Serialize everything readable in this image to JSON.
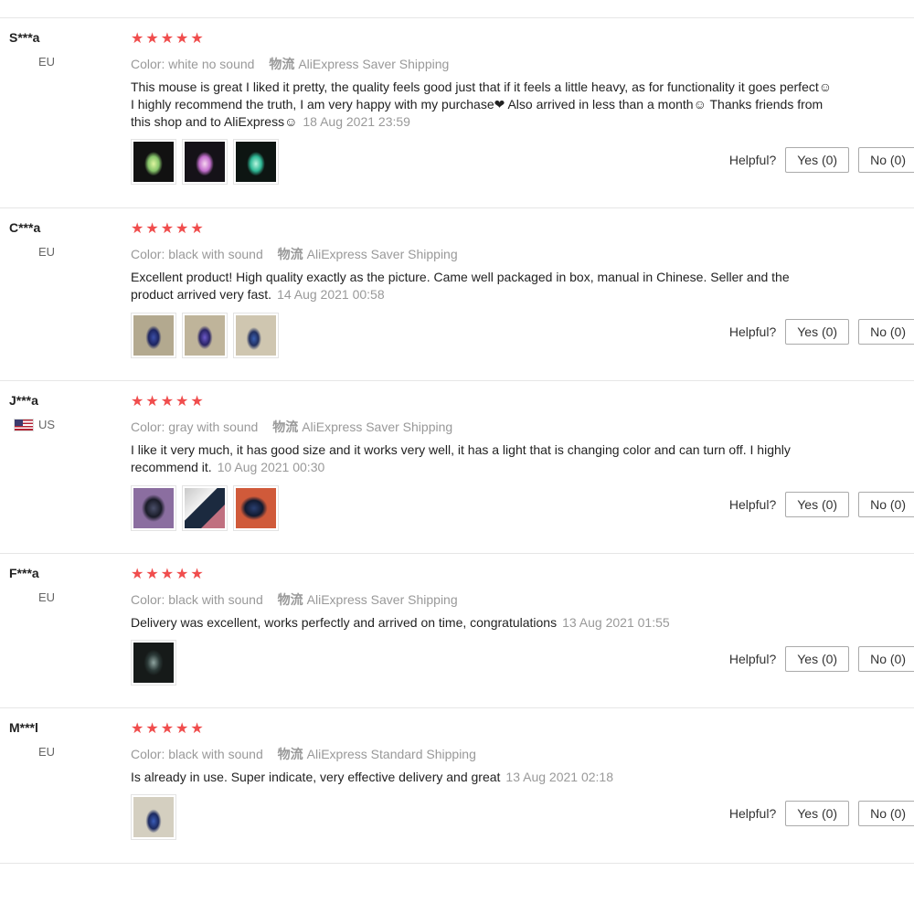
{
  "helpful_label": "Helpful?",
  "reviews": [
    {
      "name": "S***a",
      "country": "EU",
      "stars": "★★★★★",
      "color_label": "Color:",
      "color_value": "white no sound",
      "ship_cn": "物流",
      "shipping": "AliExpress Saver Shipping",
      "text": "This mouse is great I liked it pretty, the quality feels good just that if it feels a little heavy, as for functionality it goes perfect☺ I highly recommend the truth, I am very happy with my purchase❤ Also arrived in less than a month☺ Thanks friends from this shop and to AliExpress☺",
      "date": "18 Aug 2021 23:59",
      "yes": "Yes (0)",
      "no": "No (0)"
    },
    {
      "name": "C***a",
      "country": "EU",
      "stars": "★★★★★",
      "color_label": "Color:",
      "color_value": "black with sound",
      "ship_cn": "物流",
      "shipping": "AliExpress Saver Shipping",
      "text": "Excellent product! High quality exactly as the picture. Came well packaged in box, manual in Chinese. Seller and the product arrived very fast.",
      "date": "14 Aug 2021 00:58",
      "yes": "Yes (0)",
      "no": "No (0)"
    },
    {
      "name": "J***a",
      "country": "US",
      "stars": "★★★★★",
      "color_label": "Color:",
      "color_value": "gray with sound",
      "ship_cn": "物流",
      "shipping": "AliExpress Saver Shipping",
      "text": "I like it very much, it has good size and it works very well, it has a light that is changing color and can turn off. I highly recommend it.",
      "date": "10 Aug 2021 00:30",
      "yes": "Yes (0)",
      "no": "No (0)"
    },
    {
      "name": "F***a",
      "country": "EU",
      "stars": "★★★★★",
      "color_label": "Color:",
      "color_value": "black with sound",
      "ship_cn": "物流",
      "shipping": "AliExpress Saver Shipping",
      "text": "Delivery was excellent, works perfectly and arrived on time, congratulations",
      "date": "13 Aug 2021 01:55",
      "yes": "Yes (0)",
      "no": "No (0)"
    },
    {
      "name": "M***l",
      "country": "EU",
      "stars": "★★★★★",
      "color_label": "Color:",
      "color_value": "black with sound",
      "ship_cn": "物流",
      "shipping": "AliExpress Standard Shipping",
      "text": "Is already in use. Super indicate, very effective delivery and great",
      "date": "13 Aug 2021 02:18",
      "yes": "Yes (0)",
      "no": "No (0)"
    }
  ],
  "colors": {
    "star": "#f04d4d",
    "meta": "#999999",
    "divider": "#e6e6e6"
  }
}
